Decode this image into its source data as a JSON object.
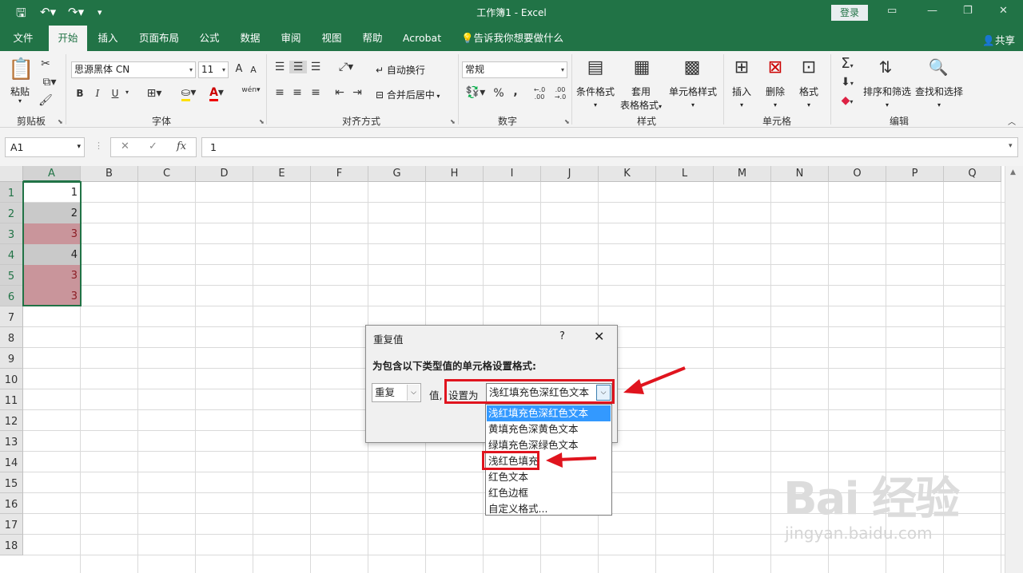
{
  "titlebar": {
    "title": "工作簿1  -  Excel",
    "login": "登录"
  },
  "menu": {
    "tabs": [
      "文件",
      "开始",
      "插入",
      "页面布局",
      "公式",
      "数据",
      "审阅",
      "视图",
      "帮助",
      "Acrobat",
      "告诉我你想要做什么"
    ],
    "active_tab": "开始",
    "share": "共享"
  },
  "ribbon": {
    "clipboard": {
      "paste": "粘贴",
      "label": "剪贴板"
    },
    "font": {
      "name": "思源黑体 CN",
      "size": "11",
      "bold": "B",
      "italic": "I",
      "underline": "U",
      "grow": "A",
      "shrink": "A",
      "font_color": "A",
      "phonetic": "wén",
      "label": "字体"
    },
    "alignment": {
      "wrap": "自动换行",
      "merge": "合并后居中",
      "label": "对齐方式"
    },
    "number": {
      "format": "常规",
      "percent": "%",
      "comma": ",",
      "inc_dec": "←.0\n.00",
      "dec_dec": ".00\n→.0",
      "label": "数字"
    },
    "styles": {
      "cond": "条件格式",
      "table": "套用",
      "table2": "表格格式",
      "cell": "单元格样式",
      "label": "样式"
    },
    "cells": {
      "insert": "插入",
      "delete": "删除",
      "format": "格式",
      "label": "单元格"
    },
    "editing": {
      "sort": "排序和筛选",
      "find": "查找和选择",
      "label": "编辑"
    }
  },
  "formula_bar": {
    "name_box": "A1",
    "fx": "fx",
    "value": "1"
  },
  "sheet": {
    "columns": [
      "A",
      "B",
      "C",
      "D",
      "E",
      "F",
      "G",
      "H",
      "I",
      "J",
      "K",
      "L",
      "M",
      "N",
      "O",
      "P",
      "Q"
    ],
    "rows": [
      "1",
      "2",
      "3",
      "4",
      "5",
      "6",
      "7",
      "8",
      "9",
      "10",
      "11",
      "12",
      "13",
      "14",
      "15",
      "16",
      "17",
      "18"
    ],
    "cells_a": [
      {
        "value": "1",
        "style": "white"
      },
      {
        "value": "2",
        "style": "gray"
      },
      {
        "value": "3",
        "style": "red"
      },
      {
        "value": "4",
        "style": "gray"
      },
      {
        "value": "3",
        "style": "red"
      },
      {
        "value": "3",
        "style": "red"
      }
    ]
  },
  "dialog": {
    "title": "重复值",
    "help": "?",
    "close": "✕",
    "description": "为包含以下类型值的单元格设置格式:",
    "type_value": "重复",
    "values_label": "值,",
    "set_as_label": "设置为",
    "format_value": "浅红填充色深红色文本",
    "options": [
      "浅红填充色深红色文本",
      "黄填充色深黄色文本",
      "绿填充色深绿色文本",
      "浅红色填充",
      "红色文本",
      "红色边框",
      "自定义格式..."
    ],
    "selected_index": 0
  },
  "colors": {
    "brand": "#217346",
    "highlight": "#e0141e",
    "dup_fill": "#c9959b",
    "dup_text": "#8b1c24"
  },
  "watermark": {
    "big": "Bai 经验",
    "small": "jingyan.baidu.com"
  }
}
